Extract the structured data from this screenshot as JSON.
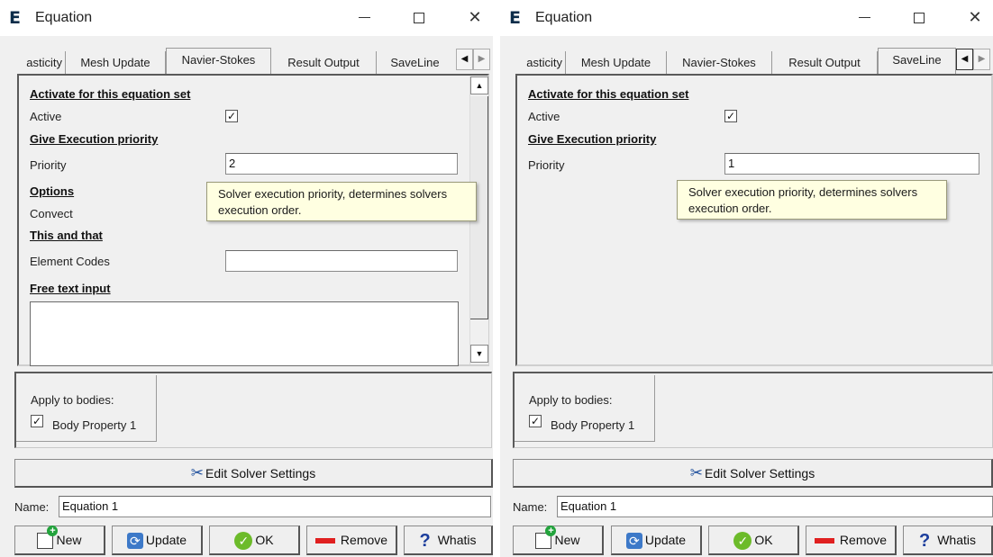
{
  "windows": [
    {
      "title": "Equation",
      "app_icon": "E",
      "tabs": [
        "asticity",
        "Mesh Update",
        "Navier-Stokes",
        "Result Output",
        "SaveLine"
      ],
      "active_tab": "Navier-Stokes",
      "section_activate": "Activate for this equation set",
      "active_label": "Active",
      "active_checked": "✓",
      "section_priority": "Give Execution priority",
      "priority_label": "Priority",
      "priority_value": "2",
      "section_options": "Options",
      "convect_label": "Convect",
      "section_this_and_that": "This and that",
      "element_codes_label": "Element Codes",
      "element_codes_value": "",
      "section_free_text": "Free text input",
      "tooltip_line1": "Solver execution priority, determines solvers",
      "tooltip_line2": "execution order.",
      "apply_to_bodies_label": "Apply to bodies:",
      "body_property": "Body Property 1",
      "body_checked": "✓",
      "edit_solver_settings": "Edit Solver Settings",
      "name_label": "Name:",
      "name_value": "Equation 1",
      "buttons": {
        "new": "New",
        "update": "Update",
        "ok": "OK",
        "remove": "Remove",
        "whatis": "Whatis"
      }
    },
    {
      "title": "Equation",
      "app_icon": "E",
      "tabs": [
        "asticity",
        "Mesh Update",
        "Navier-Stokes",
        "Result Output",
        "SaveLine"
      ],
      "active_tab": "SaveLine",
      "section_activate": "Activate for this equation set",
      "active_label": "Active",
      "active_checked": "✓",
      "section_priority": "Give Execution priority",
      "priority_label": "Priority",
      "priority_value": "1",
      "tooltip_line1": "Solver execution priority, determines solvers",
      "tooltip_line2": "execution order.",
      "apply_to_bodies_label": "Apply to bodies:",
      "body_property": "Body Property 1",
      "body_checked": "✓",
      "edit_solver_settings": "Edit Solver Settings",
      "name_label": "Name:",
      "name_value": "Equation 1",
      "buttons": {
        "new": "New",
        "update": "Update",
        "ok": "OK",
        "remove": "Remove",
        "whatis": "Whatis"
      }
    }
  ],
  "colors": {
    "tooltip_bg": "#ffffe1",
    "dialog_bg": "#f0f0f0",
    "remove_icon": "#e02020",
    "ok_icon": "#6cbb2a",
    "whatis_icon": "#1b3d9c"
  }
}
